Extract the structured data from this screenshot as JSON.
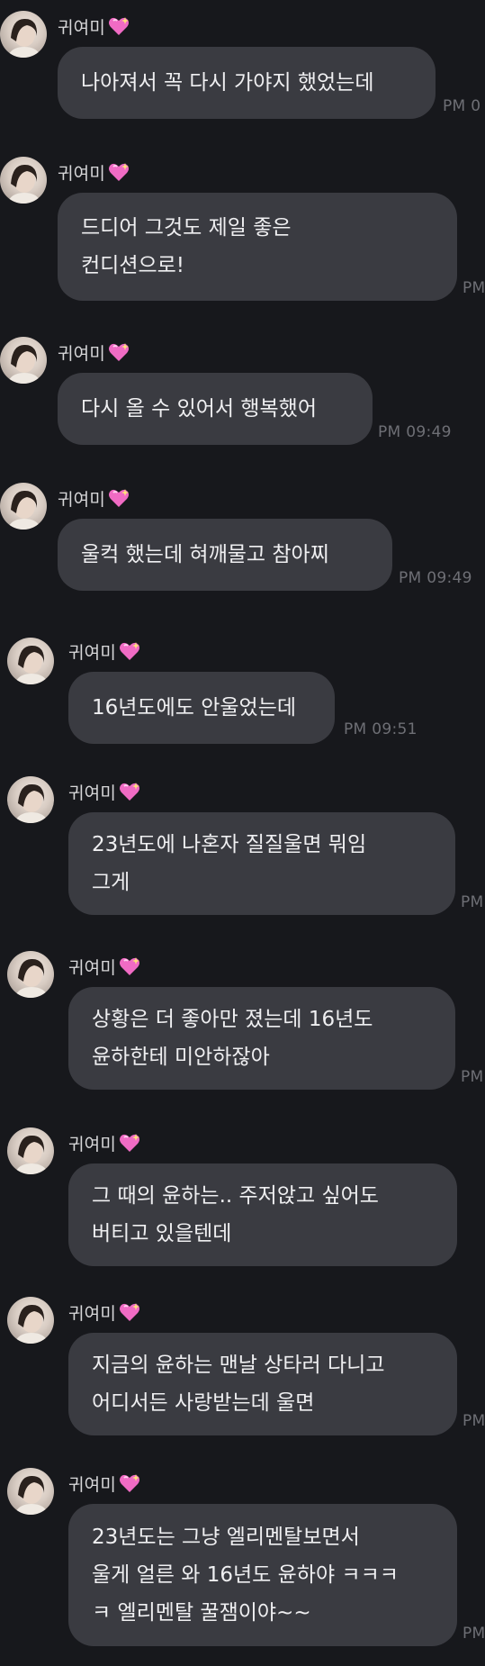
{
  "chat": {
    "sender": "귀여미",
    "messages": [
      {
        "text": "나아져서 꼭 다시 가야지 했었는데",
        "time": "PM 0"
      },
      {
        "text": "드디어 그것도 제일 좋은\n컨디션으로!",
        "time": "PM"
      },
      {
        "text": "다시 올 수 있어서 행복했어",
        "time": "PM 09:49"
      },
      {
        "text": "울컥 했는데 혀깨물고 참아찌",
        "time": "PM 09:49"
      },
      {
        "text": "16년도에도 안울었는데",
        "time": "PM 09:51"
      },
      {
        "text": "23년도에 나혼자 질질울면 뭐임\n그게",
        "time": "PM"
      },
      {
        "text": "상황은 더 좋아만 졌는데 16년도\n윤하한테 미안하잖아",
        "time": "PM"
      },
      {
        "text": "그 때의 윤하는.. 주저앉고 싶어도\n버티고 있을텐데",
        "time": ""
      },
      {
        "text": "지금의 윤하는 맨날 상타러 다니고\n어디서든 사랑받는데 울면",
        "time": "PM"
      },
      {
        "text": "23년도는 그냥 엘리멘탈보면서\n울게 얼른 와 16년도 윤하야 ㅋㅋㅋ\nㅋ 엘리멘탈 꿀잼이야~~",
        "time": "PM"
      }
    ]
  },
  "icons": {
    "avatar": "profile-photo-avatar",
    "name_emoji": "sparkling-heart-icon"
  },
  "colors": {
    "background": "#17181c",
    "bubble": "#3a3b41",
    "text": "#efeff1",
    "time": "#6e6f75",
    "heart": "#f06bc4"
  }
}
